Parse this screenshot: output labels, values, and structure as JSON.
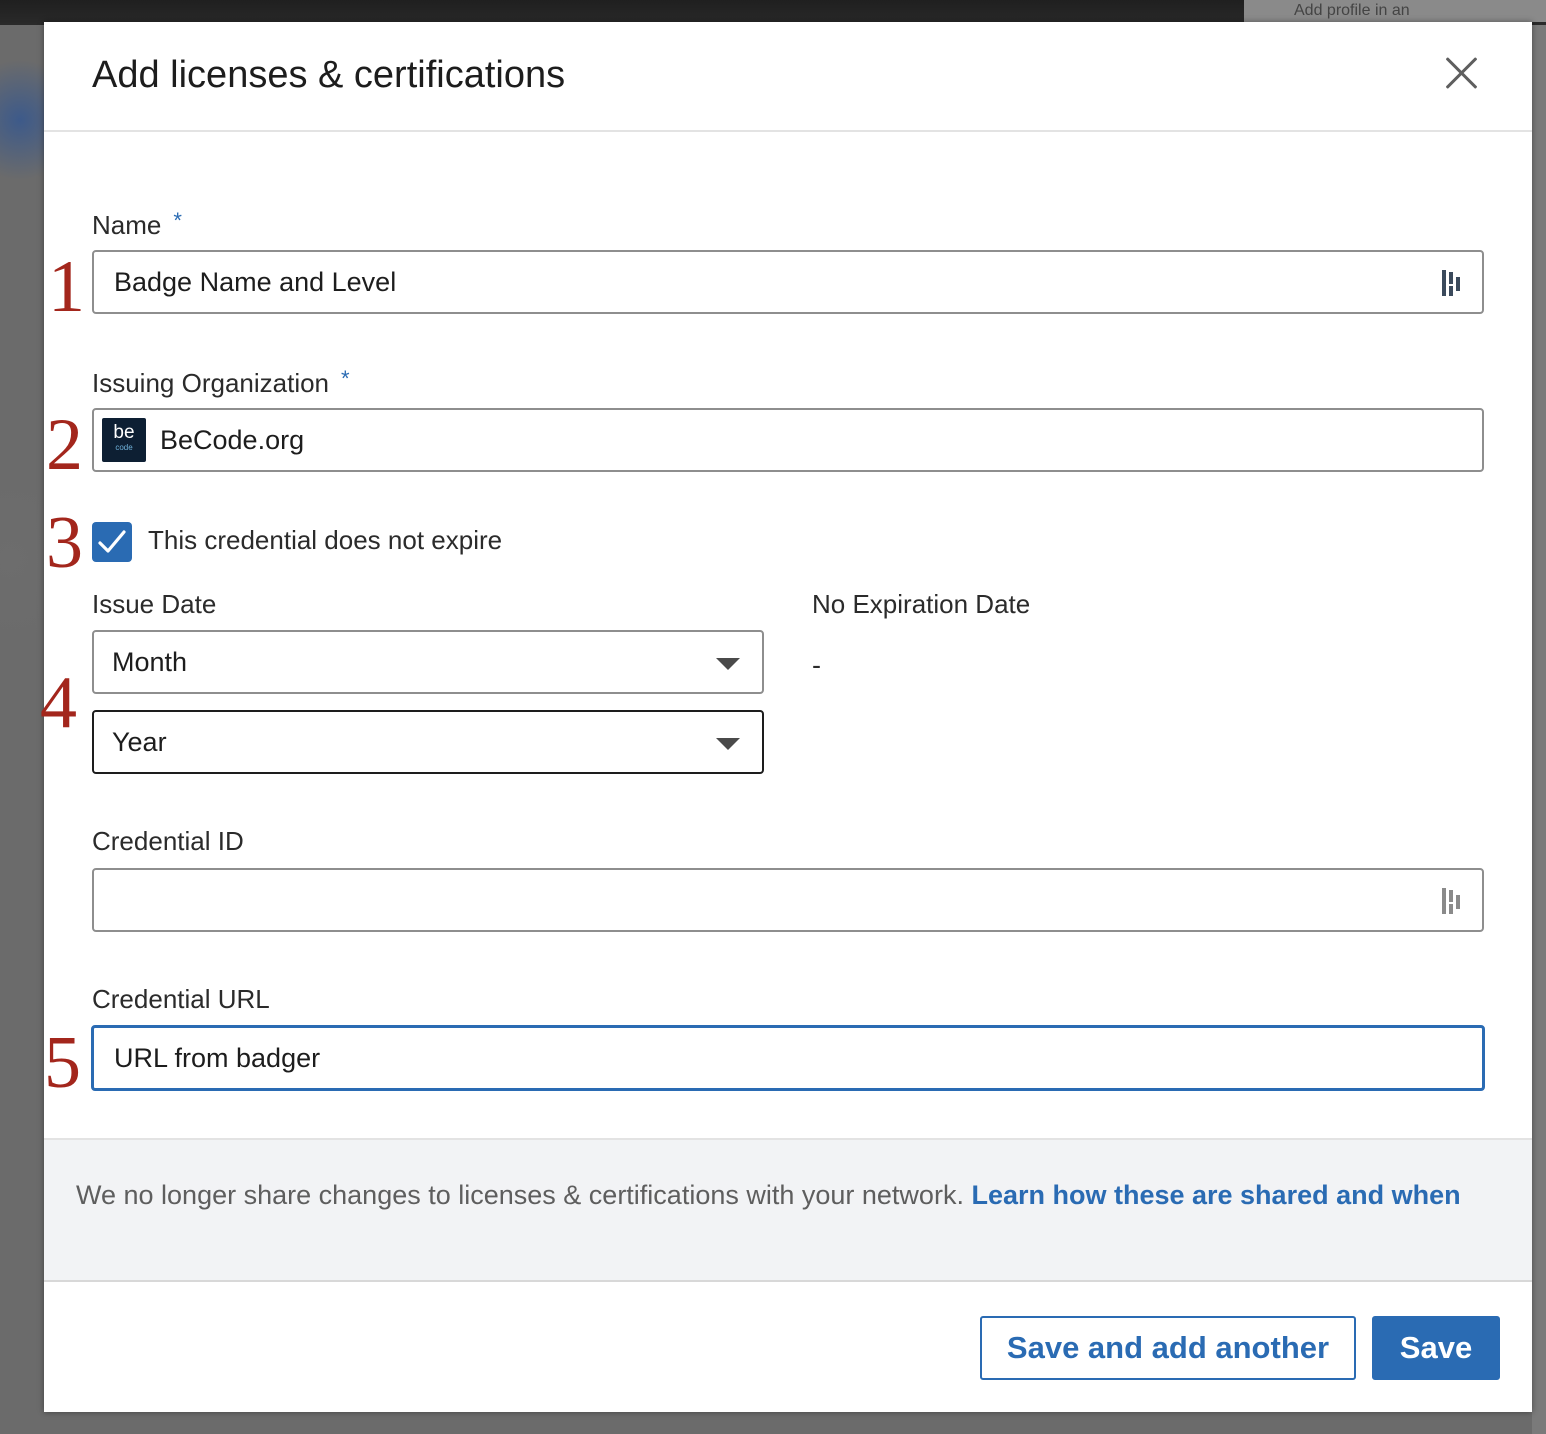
{
  "modal": {
    "title": "Add licenses & certifications"
  },
  "form": {
    "name": {
      "label": "Name",
      "required_mark": "*",
      "value": "Badge Name and Level",
      "step": "1"
    },
    "issuing_org": {
      "label": "Issuing Organization",
      "required_mark": "*",
      "value": "BeCode.org",
      "logo_text": "be",
      "logo_subtext": "code",
      "step": "2"
    },
    "no_expire": {
      "label": "This credential does not expire",
      "checked": true,
      "step": "3"
    },
    "issue_date": {
      "label": "Issue Date",
      "month_value": "Month",
      "year_value": "Year",
      "step": "4"
    },
    "expiration": {
      "label": "No Expiration Date",
      "value": "-"
    },
    "credential_id": {
      "label": "Credential ID",
      "value": ""
    },
    "credential_url": {
      "label": "Credential URL",
      "value": "URL from badger",
      "step": "5"
    }
  },
  "notice": {
    "text": "We no longer share changes to licenses & certifications with your network. ",
    "link_text": "Learn how these are shared and when"
  },
  "buttons": {
    "save_and_add_another": "Save and add another",
    "save": "Save"
  },
  "background": {
    "top_right_text": "Add profile in an"
  },
  "colors": {
    "accent": "#2a6bb3",
    "step_number": "#a3261c"
  }
}
